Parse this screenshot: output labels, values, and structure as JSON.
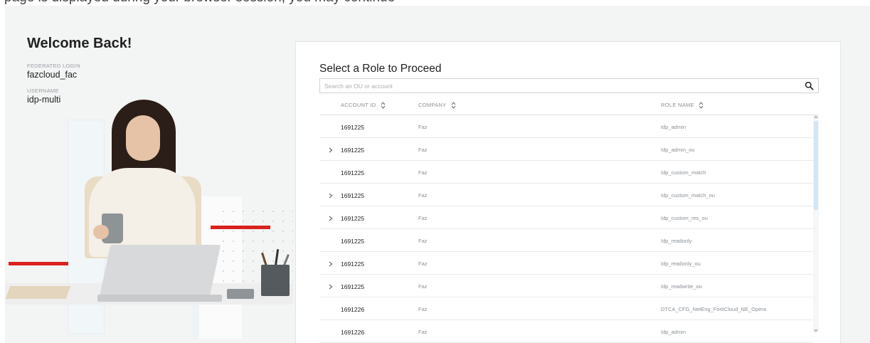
{
  "top_partial_text": "page is displayed during your browser session, you may continue",
  "welcome": {
    "title": "Welcome Back!",
    "federated_label": "FEDERATED LOGIN",
    "federated_value": "fazcloud_fac",
    "username_label": "USERNAME",
    "username_value": "idp-multi"
  },
  "panel": {
    "title": "Select a Role to Proceed",
    "search_placeholder": "Search an OU or account",
    "columns": {
      "account_id": "ACCOUNT ID",
      "company": "COMPANY",
      "role_name": "ROLE NAME"
    },
    "rows": [
      {
        "account_id": "1691225",
        "company": "Faz",
        "role": "Idp_admin",
        "expandable": false
      },
      {
        "account_id": "1691225",
        "company": "Faz",
        "role": "Idp_admin_ou",
        "expandable": true
      },
      {
        "account_id": "1691225",
        "company": "Faz",
        "role": "Idp_custom_match",
        "expandable": false
      },
      {
        "account_id": "1691225",
        "company": "Faz",
        "role": "Idp_custom_match_ou",
        "expandable": true
      },
      {
        "account_id": "1691225",
        "company": "Faz",
        "role": "Idp_custom_res_ou",
        "expandable": true
      },
      {
        "account_id": "1691225",
        "company": "Faz",
        "role": "Idp_readonly",
        "expandable": false
      },
      {
        "account_id": "1691225",
        "company": "Faz",
        "role": "Idp_readonly_ou",
        "expandable": true
      },
      {
        "account_id": "1691225",
        "company": "Faz",
        "role": "Idp_readwrite_ou",
        "expandable": true
      },
      {
        "account_id": "1691226",
        "company": "Faz",
        "role": "DTCA_CFG_NetEng_FortiCloud_NE_Opera",
        "expandable": false
      },
      {
        "account_id": "1691226",
        "company": "Faz",
        "role": "Idp_admin",
        "expandable": false
      }
    ]
  },
  "colors": {
    "accent_red": "#d9211e",
    "scroll_thumb": "#d3e6f4",
    "background": "#f3f4f4"
  },
  "icons": {
    "search": "search-icon",
    "sort": "sort-icon",
    "expand": "chevron-right-icon"
  }
}
